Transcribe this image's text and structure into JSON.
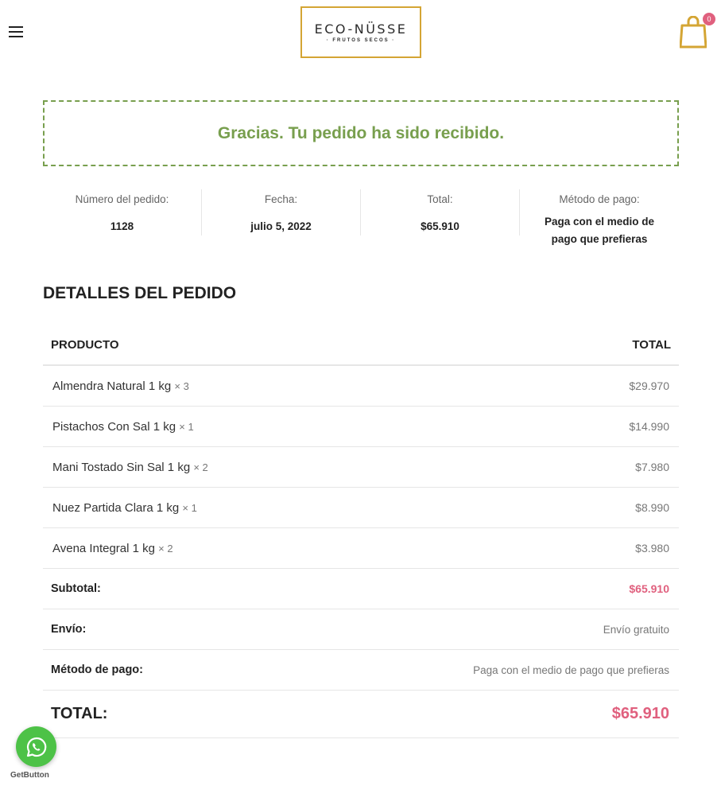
{
  "header": {
    "logo_name": "ECO-NÜSSE",
    "logo_sub": "· FRUTOS SECOS ·",
    "cart_count": "0",
    "icons": {
      "menu": "hamburger-menu-icon",
      "cart": "shopping-bag-icon"
    },
    "colors": {
      "logo_border": "#d4a534",
      "badge": "#e0607e"
    }
  },
  "notice": {
    "text": "Gracias. Tu pedido ha sido recibido.",
    "color": "#789f4e"
  },
  "overview": [
    {
      "label": "Número del pedido:",
      "value": "1128"
    },
    {
      "label": "Fecha:",
      "value": "julio 5, 2022"
    },
    {
      "label": "Total:",
      "value": "$65.910"
    },
    {
      "label": "Método de pago:",
      "value": "Paga con el medio de pago que prefieras"
    }
  ],
  "details": {
    "title": "DETALLES DEL PEDIDO",
    "col_product": "PRODUCTO",
    "col_total": "TOTAL",
    "items": [
      {
        "name": "Almendra Natural 1 kg",
        "qty": "× 3",
        "price": "$29.970"
      },
      {
        "name": "Pistachos Con Sal 1 kg",
        "qty": "× 1",
        "price": "$14.990"
      },
      {
        "name": "Mani Tostado Sin Sal 1 kg",
        "qty": "× 2",
        "price": "$7.980"
      },
      {
        "name": "Nuez Partida Clara 1 kg",
        "qty": "× 1",
        "price": "$8.990"
      },
      {
        "name": "Avena Integral 1 kg",
        "qty": "× 2",
        "price": "$3.980"
      }
    ],
    "subtotal_label": "Subtotal:",
    "subtotal_value": "$65.910",
    "shipping_label": "Envío:",
    "shipping_value": "Envío gratuito",
    "payment_label": "Método de pago:",
    "payment_value": "Paga con el medio de pago que prefieras",
    "total_label": "TOTAL:",
    "total_value": "$65.910",
    "accent": "#e0607e"
  },
  "widget": {
    "icon": "whatsapp-icon",
    "brand": "GetButton",
    "color": "#4dc247"
  }
}
